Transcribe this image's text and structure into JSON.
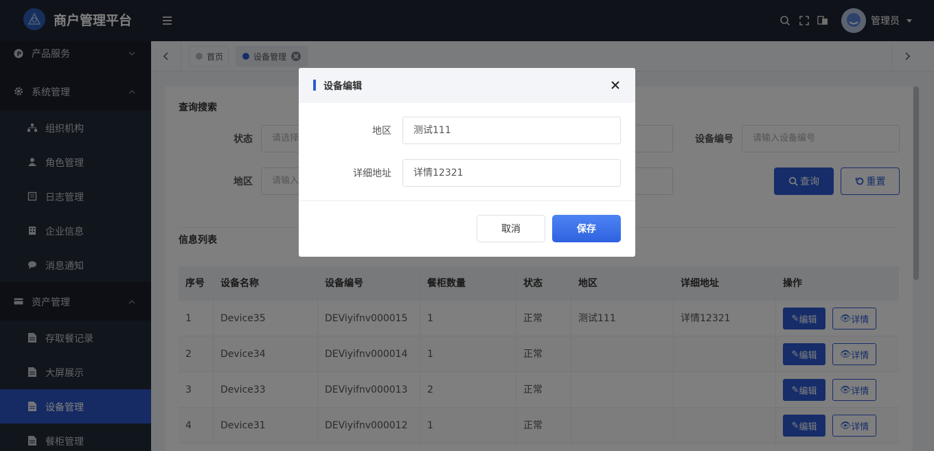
{
  "app": {
    "title": "商户管理平台"
  },
  "header": {
    "user_name": "管理员",
    "icons": [
      "search-icon",
      "fullscreen-icon",
      "translate-icon"
    ]
  },
  "sidebar": {
    "items": [
      {
        "label": "产品服务",
        "icon": "product-icon",
        "type": "group"
      },
      {
        "label": "系统管理",
        "icon": "gear-icon",
        "type": "group"
      },
      {
        "label": "组织机构",
        "icon": "org-chart-icon",
        "type": "sub"
      },
      {
        "label": "角色管理",
        "icon": "user-icon",
        "type": "sub"
      },
      {
        "label": "日志管理",
        "icon": "log-icon",
        "type": "sub"
      },
      {
        "label": "企业信息",
        "icon": "building-icon",
        "type": "sub"
      },
      {
        "label": "消息通知",
        "icon": "chat-icon",
        "type": "sub"
      },
      {
        "label": "资产管理",
        "icon": "card-icon",
        "type": "group"
      },
      {
        "label": "存取餐记录",
        "icon": "file-icon",
        "type": "sub"
      },
      {
        "label": "大屏展示",
        "icon": "file-icon",
        "type": "sub"
      },
      {
        "label": "设备管理",
        "icon": "file-icon",
        "type": "sub",
        "active": true
      },
      {
        "label": "餐柜管理",
        "icon": "file-icon",
        "type": "sub"
      }
    ]
  },
  "tabs": [
    {
      "label": "首页",
      "active": false
    },
    {
      "label": "设备管理",
      "active": true
    }
  ],
  "search": {
    "title": "查询搜索",
    "status_label": "状态",
    "status_placeholder": "请选择",
    "region_label": "地区",
    "region_placeholder": "请输入",
    "device_no_label": "设备编号",
    "device_no_placeholder": "请输入设备编号",
    "query_button": "查询",
    "reset_button": "重置"
  },
  "list": {
    "title": "信息列表",
    "columns": [
      "序号",
      "设备名称",
      "设备编号",
      "餐柜数量",
      "状态",
      "地区",
      "详细地址",
      "操作"
    ],
    "rows": [
      [
        "1",
        "Device35",
        "DEViyifnv000015",
        "1",
        "正常",
        "测试111",
        "详情12321"
      ],
      [
        "2",
        "Device34",
        "DEViyifnv000014",
        "1",
        "正常",
        "",
        ""
      ],
      [
        "3",
        "Device33",
        "DEViyifnv000013",
        "2",
        "正常",
        "",
        ""
      ],
      [
        "4",
        "Device31",
        "DEViyifnv000012",
        "1",
        "正常",
        "",
        ""
      ]
    ],
    "edit_label": "编辑",
    "detail_label": "详情"
  },
  "modal": {
    "title": "设备编辑",
    "region_label": "地区",
    "region_value": "测试111",
    "address_label": "详细地址",
    "address_value": "详情12321",
    "cancel_label": "取消",
    "save_label": "保存"
  },
  "colors": {
    "primary": "#2d5bd3",
    "sidebar_bg": "#1f2532",
    "active_nav": "#2d55c8"
  }
}
